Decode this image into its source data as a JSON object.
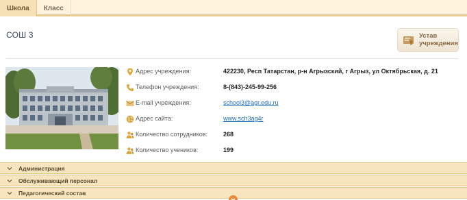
{
  "tabs": [
    {
      "label": "Школа",
      "active": true
    },
    {
      "label": "Класс",
      "active": false
    }
  ],
  "school": {
    "name": "СОШ 3"
  },
  "charter_button": {
    "line1": "Устав",
    "line2": "учреждения"
  },
  "info": {
    "address_label": "Адрес учреждения:",
    "address_value": "422230, Респ Татарстан, р-н Агрызский, г Агрыз, ул Октябрьская, д. 21",
    "phone_label": "Телефон учреждения:",
    "phone_value": "8-(843)-245-99-256",
    "email_label": "E-mail учреждения:",
    "email_value": "school3@agr.edu.ru",
    "site_label": "Адрес сайта:",
    "site_value": "www.sch3ag4r",
    "staff_label": "Количество сотрудников:",
    "staff_value": "268",
    "students_label": "Количество учеников:",
    "students_value": "199"
  },
  "accordion": [
    {
      "label": "Администрация"
    },
    {
      "label": "Обслуживающий персонал"
    },
    {
      "label": "Педагогический состав"
    }
  ],
  "colors": {
    "accent": "#e8c98c",
    "link": "#1e6fb8",
    "icon": "#e0a63a"
  }
}
